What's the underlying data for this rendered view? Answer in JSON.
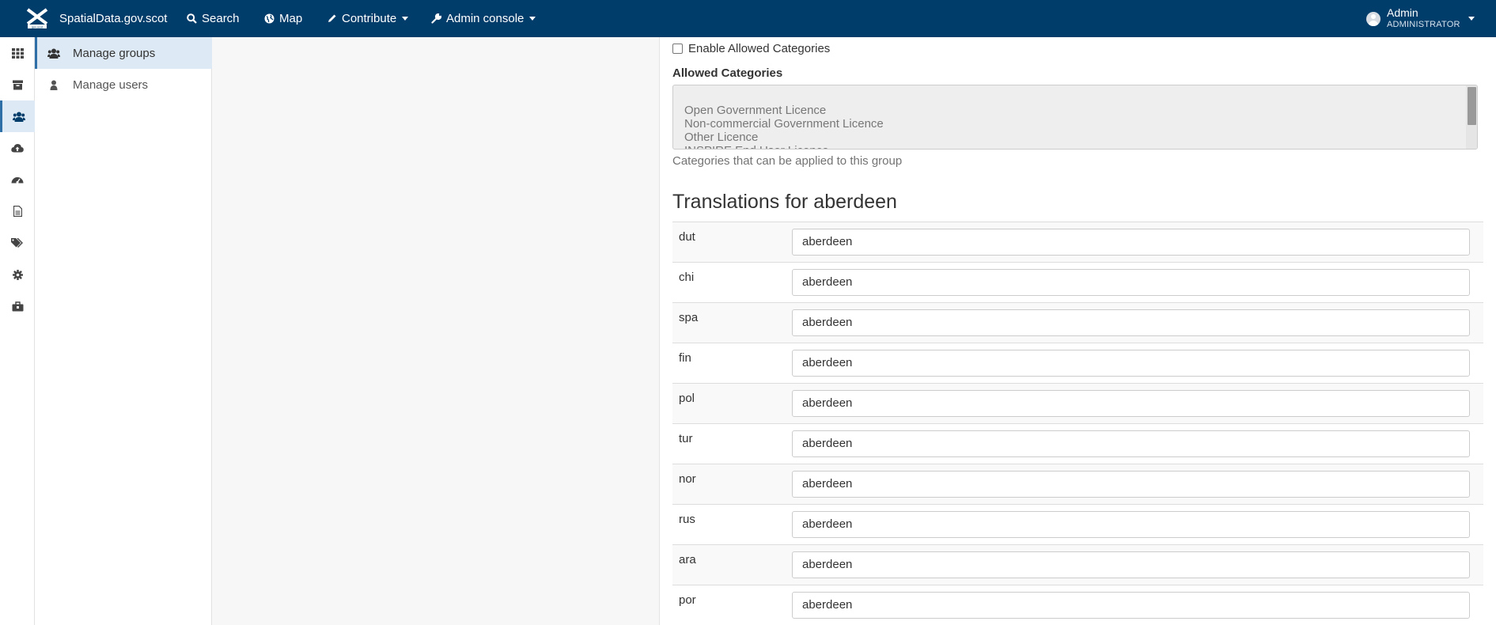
{
  "navbar": {
    "brand": "SpatialData.gov.scot",
    "search": "Search",
    "map": "Map",
    "contribute": "Contribute",
    "admin_console": "Admin console",
    "user_name": "Admin",
    "user_role": "ADMINISTRATOR"
  },
  "icon_rail": [
    "dashboard-icon",
    "archive-icon",
    "users-icon",
    "cloud-upload-icon",
    "dashboard-gauge-icon",
    "file-icon",
    "tags-icon",
    "gear-icon",
    "toolbox-icon"
  ],
  "admin_menu": {
    "manage_groups": "Manage groups",
    "manage_users": "Manage users"
  },
  "form": {
    "enable_allowed_categories": "Enable Allowed Categories",
    "enable_allowed_categories_checked": false,
    "allowed_categories_label": "Allowed Categories",
    "allowed_categories_options": [
      "Open Government Licence",
      "Non-commercial Government Licence",
      "Other Licence",
      "INSPIRE End User Licence"
    ],
    "allowed_categories_help": "Categories that can be applied to this group",
    "translations_title": "Translations for aberdeen",
    "translations": [
      {
        "lang": "dut",
        "value": "aberdeen"
      },
      {
        "lang": "chi",
        "value": "aberdeen"
      },
      {
        "lang": "spa",
        "value": "aberdeen"
      },
      {
        "lang": "fin",
        "value": "aberdeen"
      },
      {
        "lang": "pol",
        "value": "aberdeen"
      },
      {
        "lang": "tur",
        "value": "aberdeen"
      },
      {
        "lang": "nor",
        "value": "aberdeen"
      },
      {
        "lang": "rus",
        "value": "aberdeen"
      },
      {
        "lang": "ara",
        "value": "aberdeen"
      },
      {
        "lang": "por",
        "value": "aberdeen"
      }
    ]
  },
  "colors": {
    "navbar_bg": "#003d6b",
    "active_bg": "#dde9f4",
    "accent": "#2f6fa7"
  }
}
